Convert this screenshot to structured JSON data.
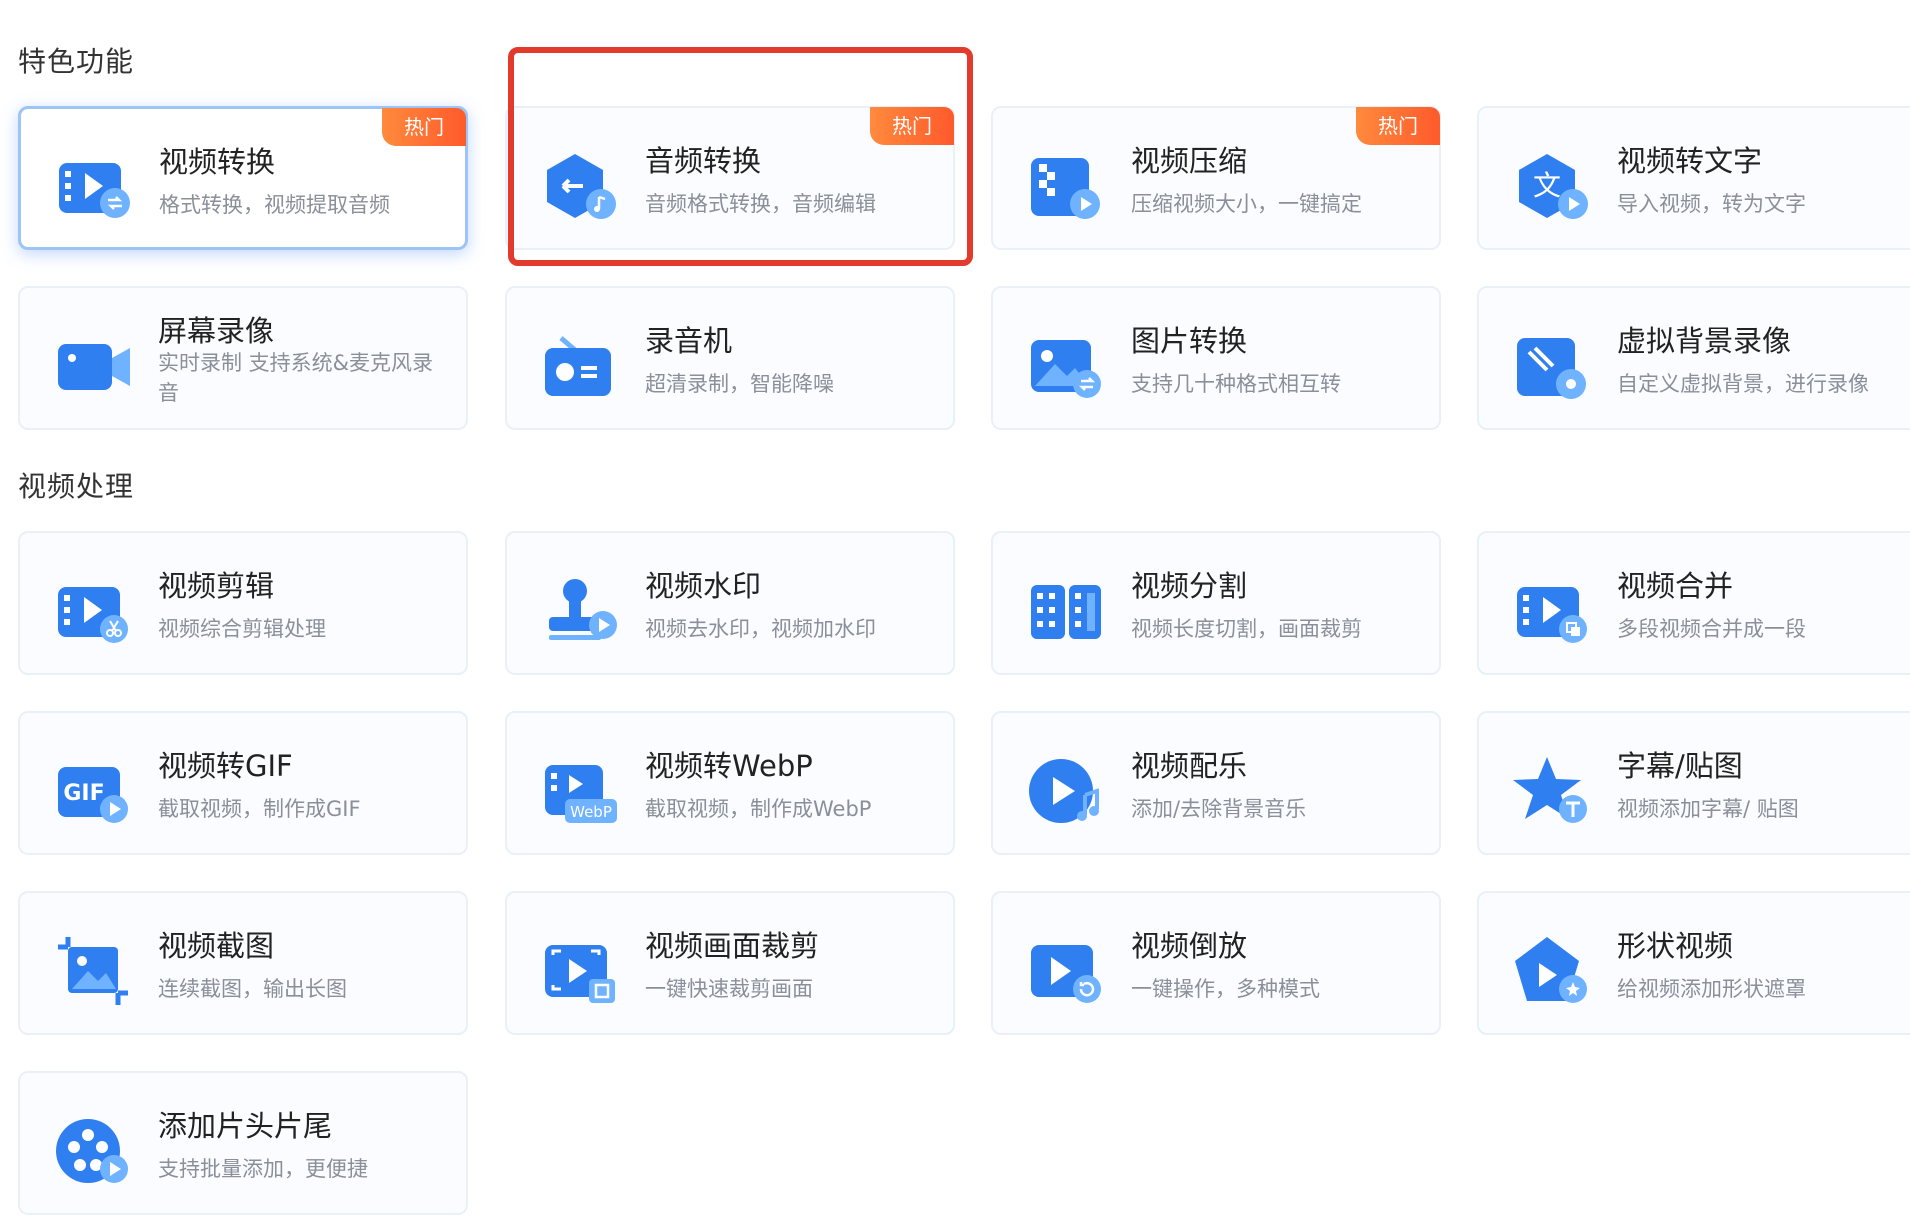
{
  "sections": {
    "featured": "特色功能",
    "video_processing": "视频处理"
  },
  "badge_hot": "热门",
  "cards": {
    "video_convert": {
      "title": "视频转换",
      "desc": "格式转换，视频提取音频"
    },
    "audio_convert": {
      "title": "音频转换",
      "desc": "音频格式转换，音频编辑"
    },
    "video_compress": {
      "title": "视频压缩",
      "desc": "压缩视频大小，一键搞定"
    },
    "video_to_text": {
      "title": "视频转文字",
      "desc": "导入视频，转为文字"
    },
    "screen_record": {
      "title": "屏幕录像",
      "desc": "实时录制 支持系统&麦克风录音"
    },
    "recorder": {
      "title": "录音机",
      "desc": "超清录制，智能降噪"
    },
    "image_convert": {
      "title": "图片转换",
      "desc": "支持几十种格式相互转"
    },
    "virtual_bg": {
      "title": "虚拟背景录像",
      "desc": "自定义虚拟背景，进行录像"
    },
    "video_edit": {
      "title": "视频剪辑",
      "desc": "视频综合剪辑处理"
    },
    "video_watermark": {
      "title": "视频水印",
      "desc": "视频去水印，视频加水印"
    },
    "video_split": {
      "title": "视频分割",
      "desc": "视频长度切割，画面裁剪"
    },
    "video_merge": {
      "title": "视频合并",
      "desc": "多段视频合并成一段"
    },
    "video_to_gif": {
      "title": "视频转GIF",
      "desc": "截取视频，制作成GIF"
    },
    "video_to_webp": {
      "title": "视频转WebP",
      "desc": "截取视频，制作成WebP"
    },
    "video_music": {
      "title": "视频配乐",
      "desc": "添加/去除背景音乐"
    },
    "subtitle_sticker": {
      "title": "字幕/贴图",
      "desc": "视频添加字幕/ 贴图"
    },
    "video_screenshot": {
      "title": "视频截图",
      "desc": "连续截图，输出长图"
    },
    "video_crop": {
      "title": "视频画面裁剪",
      "desc": "一键快速裁剪画面"
    },
    "video_reverse": {
      "title": "视频倒放",
      "desc": "一键操作，多种模式"
    },
    "shape_video": {
      "title": "形状视频",
      "desc": "给视频添加形状遮罩"
    },
    "intro_outro": {
      "title": "添加片头片尾",
      "desc": "支持批量添加，更便捷"
    }
  },
  "icon_text": {
    "text_glyph": "文",
    "gif": "GIF",
    "webp": "WebP"
  },
  "colors": {
    "accent": "#2f7ff0",
    "accent_light": "#6fb2ff",
    "badge": "#ff5a2b",
    "highlight": "#e23a2c"
  }
}
